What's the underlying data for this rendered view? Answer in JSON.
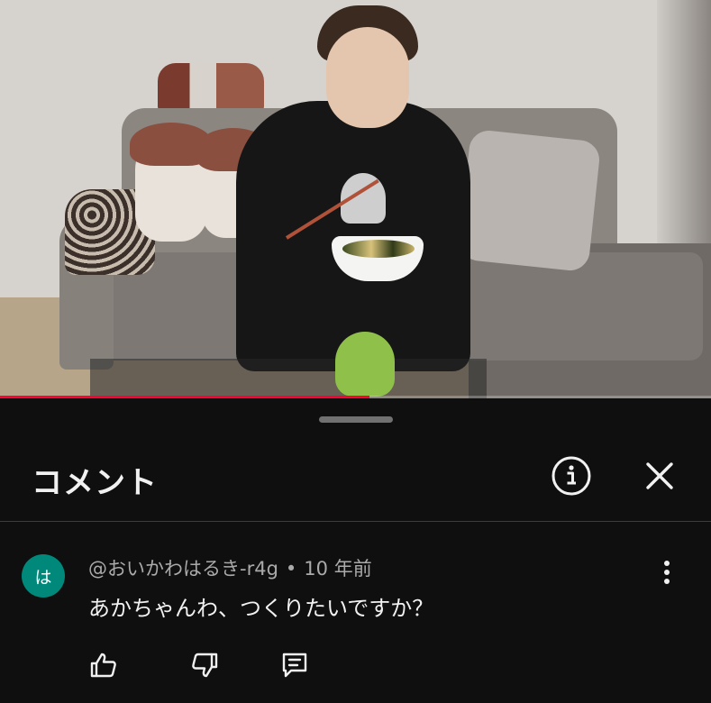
{
  "video": {
    "progress_fraction": 0.52,
    "colors": {
      "progress": "#ff0033"
    }
  },
  "comments_panel": {
    "title": "コメント",
    "icons": {
      "info": "info-icon",
      "close": "close-icon"
    }
  },
  "comments": [
    {
      "avatar_letter": "は",
      "avatar_color": "#00897b",
      "author": "@おいかわはるき-r4g",
      "separator": "•",
      "time": "10 年前",
      "text": "あかちゃんわ、つくりたいですか？",
      "icons": {
        "more": "more-vert-icon",
        "like": "thumb-up-icon",
        "dislike": "thumb-down-icon",
        "reply": "reply-icon"
      }
    }
  ]
}
